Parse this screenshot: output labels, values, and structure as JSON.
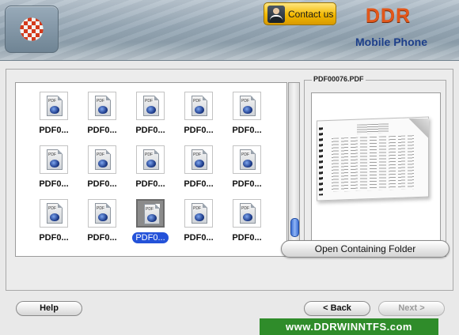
{
  "header": {
    "contact_label": "Contact us",
    "brand": "DDR",
    "product": "Mobile Phone",
    "logo_icon": "checker-ball-logo-icon",
    "contact_icon": "person-icon"
  },
  "files": [
    {
      "label": "PDF0..."
    },
    {
      "label": "PDF0..."
    },
    {
      "label": "PDF0..."
    },
    {
      "label": "PDF0..."
    },
    {
      "label": "PDF0..."
    },
    {
      "label": "PDF0..."
    },
    {
      "label": "PDF0..."
    },
    {
      "label": "PDF0..."
    },
    {
      "label": "PDF0..."
    },
    {
      "label": "PDF0..."
    },
    {
      "label": "PDF0..."
    },
    {
      "label": "PDF0..."
    },
    {
      "label": "PDF0...",
      "selected": true
    },
    {
      "label": "PDF0..."
    },
    {
      "label": "PDF0..."
    }
  ],
  "file_icon_text": "PDF",
  "preview": {
    "title": "PDF00076.PDF",
    "open_folder_label": "Open Containing Folder"
  },
  "footer": {
    "help_label": "Help",
    "back_label": "< Back",
    "next_label": "Next >",
    "url": "www.DDRWINNTFS.com"
  },
  "colors": {
    "brand": "#e2571a",
    "product": "#1d3f8a",
    "selection": "#2452d9",
    "url_bar": "#2f8c2a"
  }
}
